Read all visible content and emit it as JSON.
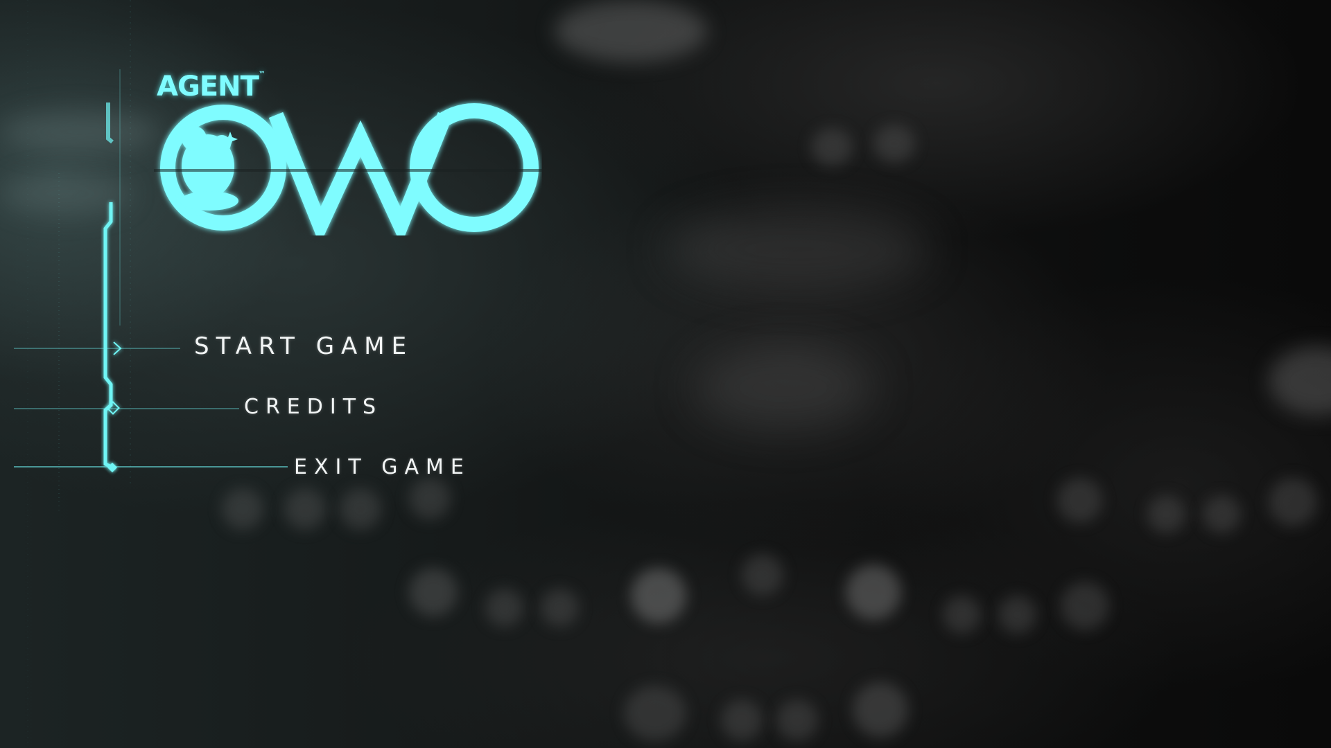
{
  "logo": {
    "agent_text": "AGENT",
    "title_text": "OWO",
    "trademark": "™"
  },
  "menu": {
    "items": [
      {
        "label": "START GAME"
      },
      {
        "label": "CREDITS"
      },
      {
        "label": "EXIT GAME"
      }
    ]
  },
  "colors": {
    "accent": "#6ff5f5",
    "menu_text": "#f2f5f5",
    "background": "#101111"
  },
  "icons": {
    "mascot": "mascot-silhouette-icon",
    "star": "sparkle-icon"
  }
}
